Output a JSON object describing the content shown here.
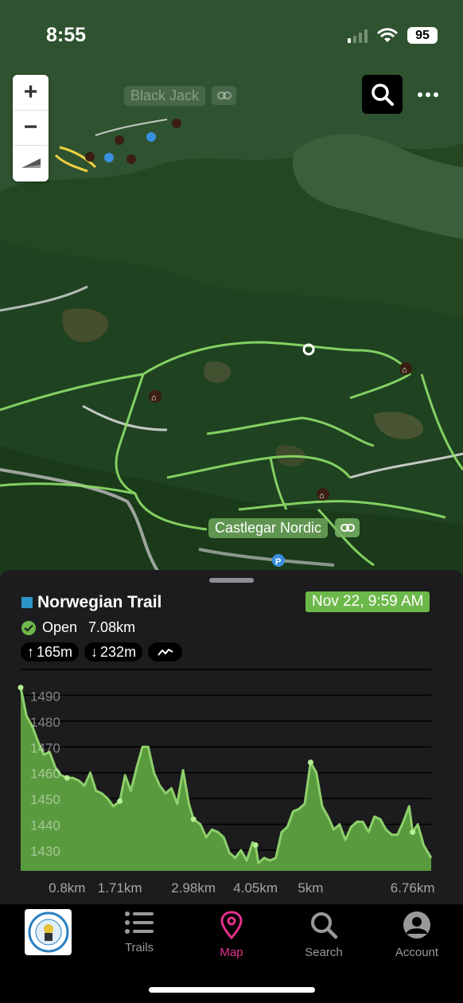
{
  "status": {
    "time": "8:55",
    "battery": "95"
  },
  "map": {
    "zoom_in": "+",
    "zoom_out": "−",
    "labels": {
      "black_jack": "Black Jack",
      "castlegar": "Castlegar Nordic"
    }
  },
  "trail": {
    "name": "Norwegian Trail",
    "swatch_color": "#2d95c5",
    "date": "Nov 22, 9:59 AM",
    "status": "Open",
    "length": "7.08km",
    "ascent": "165m",
    "descent": "232m"
  },
  "chart_data": {
    "type": "area",
    "y_ticks": [
      "1490",
      "1480",
      "1470",
      "1460",
      "1450",
      "1440",
      "1430"
    ],
    "x_ticks": [
      "0.8km",
      "1.71km",
      "2.98km",
      "4.05km",
      "5km",
      "6.76km"
    ],
    "ylim": [
      1422,
      1500
    ],
    "x_km": [
      0,
      0.1,
      0.2,
      0.3,
      0.4,
      0.5,
      0.6,
      0.7,
      0.8,
      0.9,
      1.0,
      1.1,
      1.2,
      1.3,
      1.4,
      1.5,
      1.6,
      1.71,
      1.8,
      1.9,
      2.0,
      2.1,
      2.2,
      2.3,
      2.4,
      2.5,
      2.6,
      2.7,
      2.8,
      2.9,
      2.98,
      3.1,
      3.2,
      3.3,
      3.4,
      3.5,
      3.6,
      3.7,
      3.8,
      3.9,
      4.0,
      4.05,
      4.1,
      4.2,
      4.3,
      4.4,
      4.5,
      4.6,
      4.7,
      4.8,
      4.9,
      5.0,
      5.1,
      5.2,
      5.3,
      5.4,
      5.5,
      5.6,
      5.7,
      5.8,
      5.9,
      6.0,
      6.1,
      6.2,
      6.3,
      6.4,
      6.5,
      6.6,
      6.7,
      6.76,
      6.85,
      6.95,
      7.08
    ],
    "elevation_m": [
      1493,
      1482,
      1478,
      1472,
      1467,
      1468,
      1462,
      1459,
      1458,
      1458,
      1457,
      1455,
      1460,
      1453,
      1452,
      1450,
      1447,
      1449,
      1459,
      1453,
      1462,
      1470,
      1470,
      1460,
      1455,
      1452,
      1454,
      1448,
      1461,
      1448,
      1442,
      1440,
      1435,
      1438,
      1437,
      1435,
      1429,
      1427,
      1430,
      1426,
      1433,
      1432,
      1425,
      1427,
      1426,
      1427,
      1437,
      1439,
      1445,
      1446,
      1448,
      1464,
      1460,
      1447,
      1443,
      1438,
      1440,
      1434,
      1439,
      1441,
      1441,
      1437,
      1443,
      1442,
      1438,
      1436,
      1436,
      1441,
      1447,
      1437,
      1440,
      1432,
      1427
    ],
    "markers_km": [
      0,
      0.8,
      1.71,
      2.98,
      4.05,
      5.0,
      6.76
    ],
    "fill_color": "#5a9a3e",
    "line_color": "#8ed06a"
  },
  "tabs": [
    {
      "label": "Trails",
      "icon": "list-icon"
    },
    {
      "label": "Map",
      "icon": "map-pin-icon"
    },
    {
      "label": "Search",
      "icon": "search-icon"
    },
    {
      "label": "Account",
      "icon": "account-icon"
    }
  ]
}
